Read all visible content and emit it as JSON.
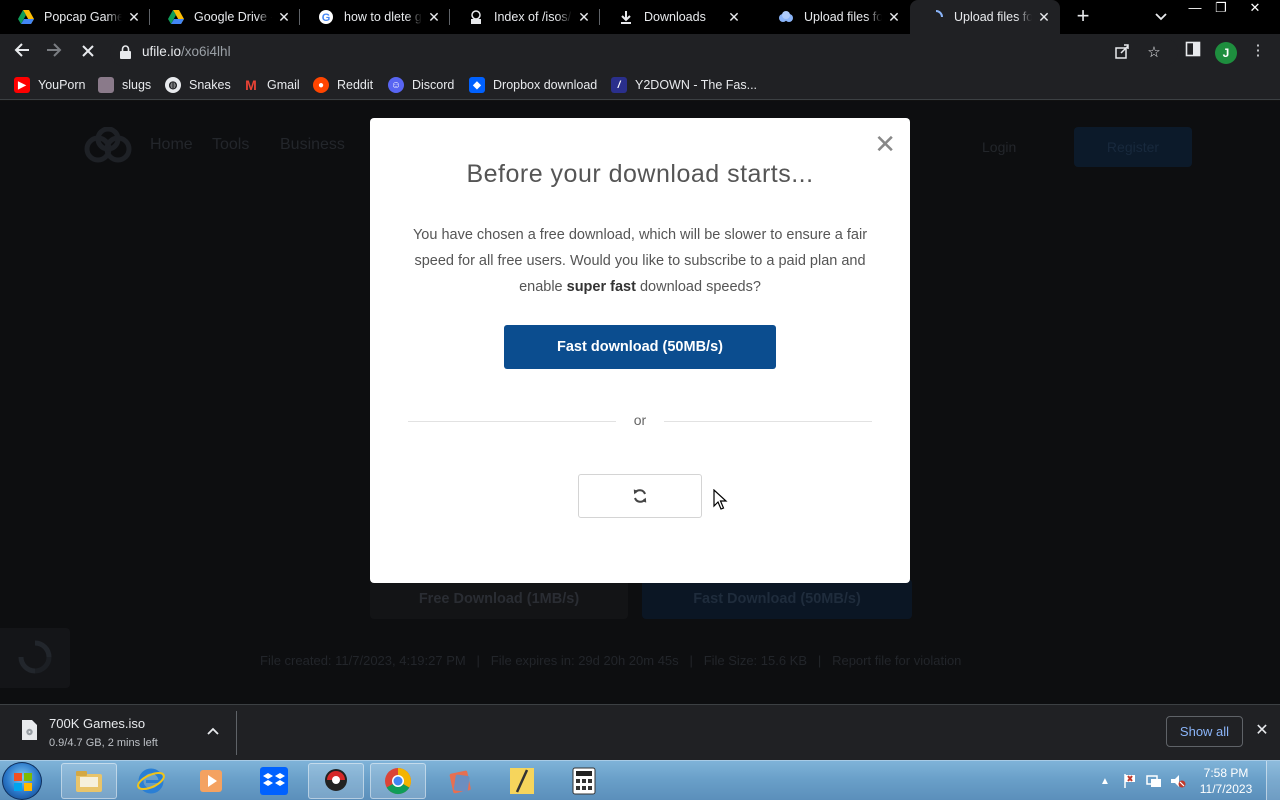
{
  "tabs": [
    {
      "title": "Popcap Game C",
      "icon": "google-drive-icon"
    },
    {
      "title": "Google Drive - V",
      "icon": "google-drive-icon"
    },
    {
      "title": "how to dlete go",
      "icon": "google-icon"
    },
    {
      "title": "Index of /isos/",
      "icon": "archive-icon"
    },
    {
      "title": "Downloads",
      "icon": "download-icon"
    },
    {
      "title": "Upload files for",
      "icon": "ufile-icon"
    },
    {
      "title": "Upload files for",
      "icon": "loading-spinner-icon",
      "active": true
    }
  ],
  "address_bar": {
    "domain": "ufile.io",
    "path": "/xo6i4lhl"
  },
  "profile_initial": "J",
  "bookmarks": [
    {
      "label": "YouPorn",
      "icon": "youtube-icon",
      "color": "#ff0000"
    },
    {
      "label": "slugs",
      "icon": "image-icon",
      "color": "#8a7a8a"
    },
    {
      "label": "Snakes",
      "icon": "globe-icon",
      "color": "#e8eaed"
    },
    {
      "label": "Gmail",
      "icon": "gmail-icon",
      "color": "#ea4335"
    },
    {
      "label": "Reddit",
      "icon": "reddit-icon",
      "color": "#ff4500"
    },
    {
      "label": "Discord",
      "icon": "discord-icon",
      "color": "#5865f2"
    },
    {
      "label": "Dropbox download",
      "icon": "dropbox-icon",
      "color": "#0061ff"
    },
    {
      "label": "Y2DOWN - The Fas...",
      "icon": "y2down-icon",
      "color": "#2a2f8c"
    }
  ],
  "page": {
    "nav": [
      "Home",
      "Tools",
      "Business"
    ],
    "login": "Login",
    "register": "Register",
    "free_download": "Free Download (1MB/s)",
    "fast_download": "Fast Download (50MB/s)",
    "meta": "File created: 11/7/2023, 4:19:27 PM   |   File expires in: 29d 20h 20m 45s   |   File Size: 15.6 KB   |   Report file for violation"
  },
  "modal": {
    "title": "Before your download starts...",
    "body_before": "You have chosen a free download, which will be slower to ensure a fair speed for all free users. Would you like to subscribe to a paid plan and enable ",
    "body_bold": "super fast",
    "body_after": " download speeds?",
    "fast_button": "Fast download (50MB/s)",
    "or_text": "or",
    "accent_color": "#0b4d8f"
  },
  "download_bar": {
    "filename": "700K Games.iso",
    "status": "0.9/4.7 GB, 2 mins left",
    "show_all": "Show all"
  },
  "taskbar": {
    "time": "7:58 PM",
    "date": "11/7/2023"
  }
}
